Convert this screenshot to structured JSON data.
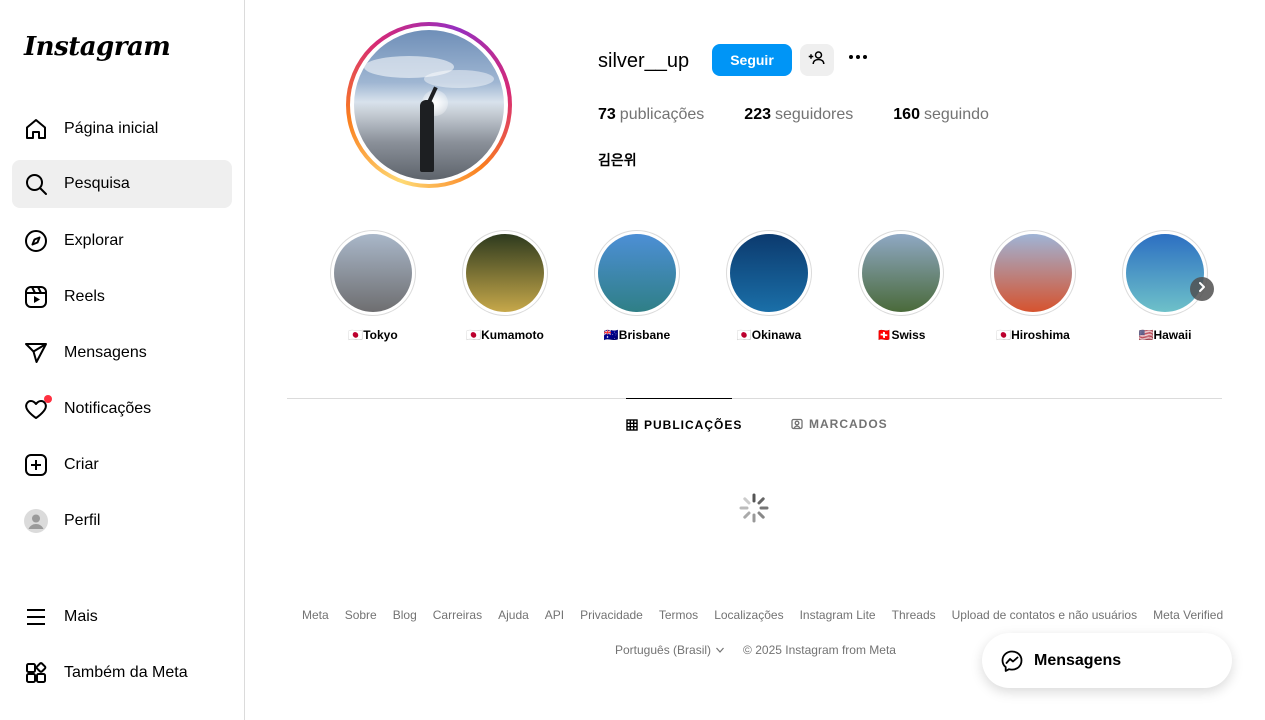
{
  "sidebar": {
    "logo": "Instagram",
    "items": [
      {
        "label": "Página inicial",
        "icon": "home-icon"
      },
      {
        "label": "Pesquisa",
        "icon": "search-icon"
      },
      {
        "label": "Explorar",
        "icon": "compass-icon"
      },
      {
        "label": "Reels",
        "icon": "reels-icon"
      },
      {
        "label": "Mensagens",
        "icon": "send-icon"
      },
      {
        "label": "Notificações",
        "icon": "heart-icon"
      },
      {
        "label": "Criar",
        "icon": "plus-square-icon"
      },
      {
        "label": "Perfil",
        "icon": "avatar-icon"
      },
      {
        "label": "Mais",
        "icon": "menu-icon"
      },
      {
        "label": "Também da Meta",
        "icon": "meta-apps-icon"
      }
    ],
    "active_item": "Pesquisa"
  },
  "profile": {
    "username": "silver__up",
    "follow_label": "Seguir",
    "full_name": "김은위",
    "stats": {
      "posts_count": "73",
      "posts_label": "publicações",
      "followers_count": "223",
      "followers_label": "seguidores",
      "following_count": "160",
      "following_label": "seguindo"
    }
  },
  "highlights": [
    {
      "label": "🇯🇵Tokyo",
      "colors": [
        "#a9b7c9",
        "#6e6e70"
      ]
    },
    {
      "label": "🇯🇵Kumamoto",
      "colors": [
        "#2d3a1e",
        "#c7a84a"
      ]
    },
    {
      "label": "🇦🇺Brisbane",
      "colors": [
        "#4d8fd6",
        "#2f7f86"
      ]
    },
    {
      "label": "🇯🇵Okinawa",
      "colors": [
        "#0c3a6e",
        "#1a6fa8"
      ]
    },
    {
      "label": "🇨🇭Swiss",
      "colors": [
        "#8fa8c4",
        "#4a6a3a"
      ]
    },
    {
      "label": "🇯🇵Hiroshima",
      "colors": [
        "#9fb4d6",
        "#d6532e"
      ]
    },
    {
      "label": "🇺🇸Hawaii",
      "colors": [
        "#2c6fc2",
        "#6ec1c9"
      ]
    }
  ],
  "tabs": [
    {
      "label": "PUBLICAÇÕES",
      "icon": "grid-icon",
      "active": true
    },
    {
      "label": "MARCADOS",
      "icon": "tagged-icon",
      "active": false
    }
  ],
  "footer": {
    "links": [
      "Meta",
      "Sobre",
      "Blog",
      "Carreiras",
      "Ajuda",
      "API",
      "Privacidade",
      "Termos",
      "Localizações",
      "Instagram Lite",
      "Threads",
      "Upload de contatos e não usuários",
      "Meta Verified"
    ],
    "language": "Português (Brasil)",
    "copyright": "© 2025 Instagram from Meta"
  },
  "messages_pill": {
    "label": "Mensagens"
  }
}
